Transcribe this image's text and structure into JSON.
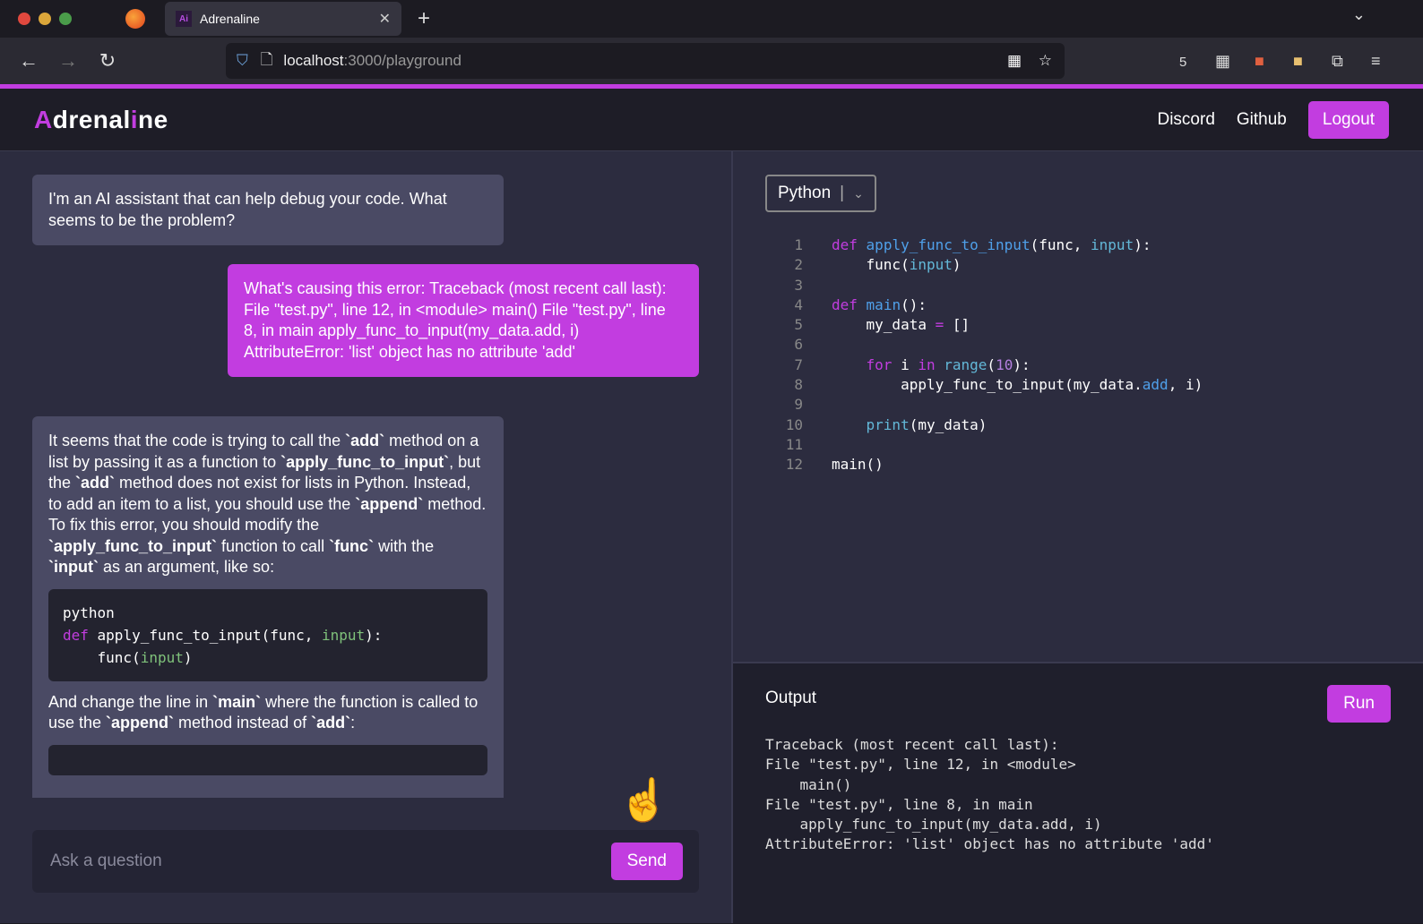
{
  "browser": {
    "tab_title": "Adrenaline",
    "tab_favicon": "Ai",
    "url_host": "localhost",
    "url_path": ":3000/playground",
    "ext_badge": "5"
  },
  "header": {
    "logo_a": "A",
    "logo_mid": "drenal",
    "logo_i": "i",
    "logo_end": "ne",
    "nav": [
      "Discord",
      "Github"
    ],
    "logout": "Logout"
  },
  "chat": {
    "greeting": "I'm an AI assistant that can help debug your code. What seems to be the problem?",
    "user_message": "What's causing this error: Traceback (most recent call last): File \"test.py\", line 12, in <module> main() File \"test.py\", line 8, in main apply_func_to_input(my_data.add, i) AttributeError: 'list' object has no attribute 'add'",
    "reply_p1": [
      [
        "It seems that the code is trying to call the ",
        0
      ],
      [
        "`add`",
        1
      ],
      [
        " method on a list by passing it as a function to ",
        0
      ],
      [
        "`apply_func_to_input`",
        1
      ],
      [
        ", but the ",
        0
      ],
      [
        "`add`",
        1
      ],
      [
        " method does not exist for lists in Python. Instead, to add an item to a list, you should use the ",
        0
      ],
      [
        "`append`",
        1
      ],
      [
        " method. To fix this error, you should modify the ",
        0
      ],
      [
        "`apply_func_to_input`",
        1
      ],
      [
        " function to call ",
        0
      ],
      [
        "`func`",
        1
      ],
      [
        " with the ",
        0
      ],
      [
        "`input`",
        1
      ],
      [
        " as an argument, like so:",
        0
      ]
    ],
    "reply_code": [
      [
        [
          "python",
          ""
        ]
      ],
      [
        [
          "def",
          "kw"
        ],
        [
          " apply_func_to_input(func, ",
          ""
        ],
        [
          "input",
          "gr"
        ],
        [
          "):",
          ""
        ]
      ],
      [
        [
          "    func(",
          ""
        ],
        [
          "input",
          "gr"
        ],
        [
          ")",
          ""
        ]
      ]
    ],
    "reply_p2": [
      [
        "And change the line in ",
        0
      ],
      [
        "`main`",
        1
      ],
      [
        " where the function is called to use the ",
        0
      ],
      [
        "`append`",
        1
      ],
      [
        " method instead of ",
        0
      ],
      [
        "`add`",
        1
      ],
      [
        ":",
        0
      ]
    ],
    "input_placeholder": "Ask a question",
    "send": "Send"
  },
  "editor": {
    "language": "Python",
    "lines": [
      [
        [
          "def",
          "kw"
        ],
        [
          " ",
          ""
        ],
        [
          "apply_func_to_input",
          "fn"
        ],
        [
          "(func, ",
          ""
        ],
        [
          "input",
          "pa"
        ],
        [
          "):",
          ""
        ]
      ],
      [
        [
          "    func(",
          ""
        ],
        [
          "input",
          "pa"
        ],
        [
          ")",
          ""
        ]
      ],
      [],
      [
        [
          "def",
          "kw"
        ],
        [
          " ",
          ""
        ],
        [
          "main",
          "fn"
        ],
        [
          "():",
          ""
        ]
      ],
      [
        [
          "    my_data ",
          ""
        ],
        [
          "=",
          "kw"
        ],
        [
          " []",
          ""
        ]
      ],
      [],
      [
        [
          "    ",
          ""
        ],
        [
          "for",
          "kw"
        ],
        [
          " i ",
          ""
        ],
        [
          "in",
          "kw"
        ],
        [
          " ",
          ""
        ],
        [
          "range",
          "pa"
        ],
        [
          "(",
          ""
        ],
        [
          "10",
          "nm"
        ],
        [
          "):",
          ""
        ]
      ],
      [
        [
          "        apply_func_to_input(my_data.",
          ""
        ],
        [
          "add",
          "fn"
        ],
        [
          ", i)",
          ""
        ]
      ],
      [],
      [
        [
          "    ",
          ""
        ],
        [
          "print",
          "pa"
        ],
        [
          "(my_data)",
          ""
        ]
      ],
      [],
      [
        [
          "main()",
          ""
        ]
      ]
    ]
  },
  "output": {
    "title": "Output",
    "run": "Run",
    "text": "Traceback (most recent call last):\nFile \"test.py\", line 12, in <module>\n    main()\nFile \"test.py\", line 8, in main\n    apply_func_to_input(my_data.add, i)\nAttributeError: 'list' object has no attribute 'add'"
  },
  "colors": {
    "accent": "#c23de0",
    "bg": "#2c2c3f"
  }
}
